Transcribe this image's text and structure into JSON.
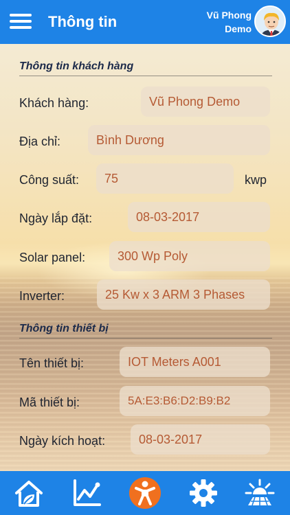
{
  "header": {
    "title": "Thông tin",
    "user_name": "Vũ Phong",
    "user_sub": "Demo"
  },
  "customer_section": {
    "title": "Thông tin khách hàng",
    "fields": [
      {
        "label": "Khách hàng:",
        "value": "Vũ Phong Demo"
      },
      {
        "label": "Địa chỉ:",
        "value": "Bình Dương"
      },
      {
        "label": "Công suất:",
        "value": "75",
        "unit": "kwp"
      },
      {
        "label": "Ngày lắp đặt:",
        "value": "08-03-2017"
      },
      {
        "label": "Solar panel:",
        "value": "300 Wp Poly"
      },
      {
        "label": "Inverter:",
        "value": "25 Kw x 3 ARM 3 Phases"
      }
    ]
  },
  "device_section": {
    "title": "Thông tin thiết bị",
    "fields": [
      {
        "label": "Tên thiết bị:",
        "value": "IOT Meters A001"
      },
      {
        "label": "Mã thiết bị:",
        "value": "5A:E3:B6:D2:B9:B2"
      },
      {
        "label": "Ngày kích hoạt:",
        "value": "08-03-2017"
      }
    ]
  },
  "bottom_nav": {
    "items": [
      {
        "icon": "eco-home-icon",
        "active": false
      },
      {
        "icon": "line-chart-icon",
        "active": false
      },
      {
        "icon": "person-info-icon",
        "active": true
      },
      {
        "icon": "gear-icon",
        "active": false
      },
      {
        "icon": "sun-panel-icon",
        "active": false
      }
    ]
  },
  "colors": {
    "primary": "#1e83e6",
    "accent": "#f0701f",
    "value_text": "#b55a34"
  }
}
